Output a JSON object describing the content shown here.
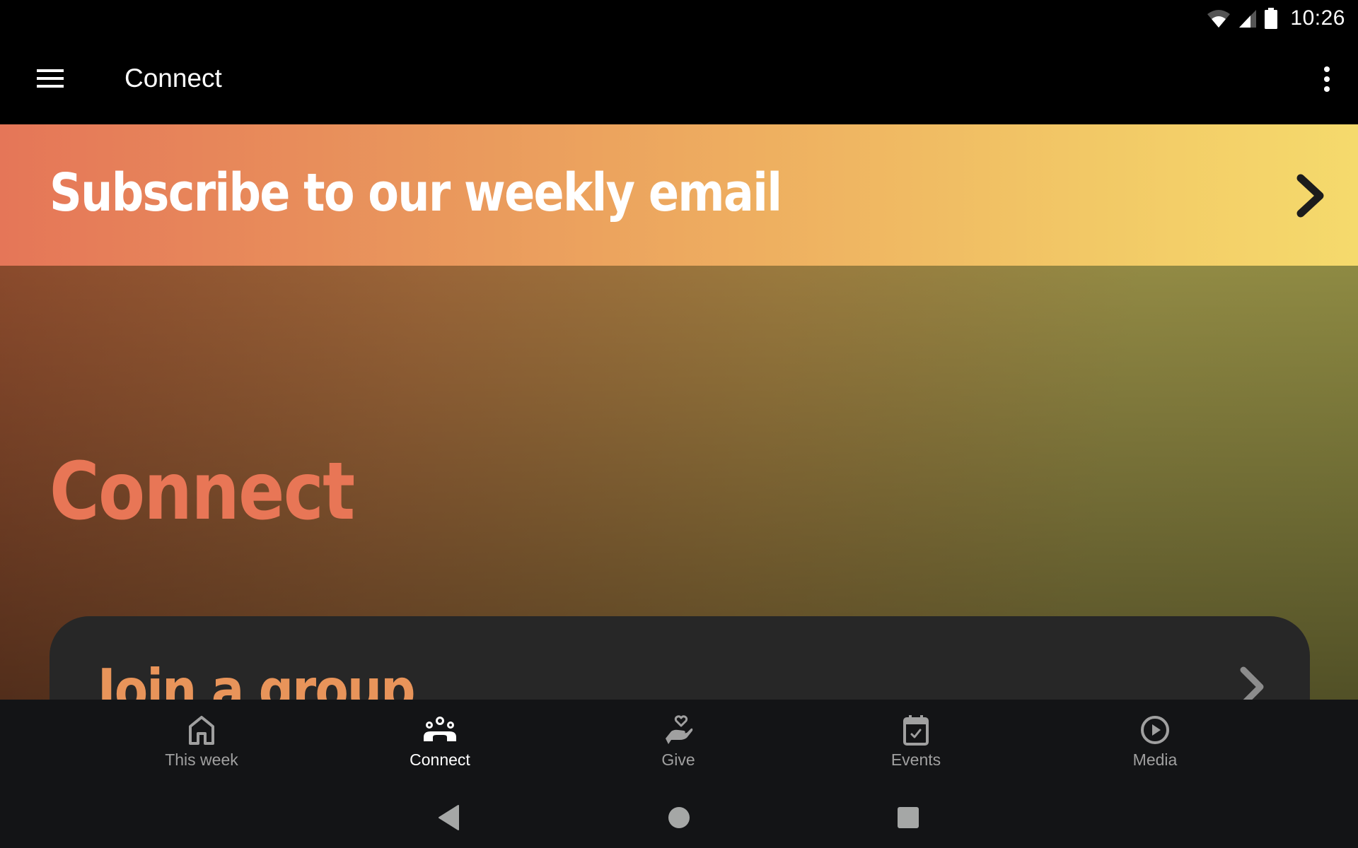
{
  "status_bar": {
    "time": "10:26",
    "icons": [
      "wifi-icon",
      "cell-signal-icon",
      "battery-icon"
    ]
  },
  "app_bar": {
    "menu_icon": "hamburger-menu-icon",
    "title": "Connect",
    "overflow_icon": "more-vert-icon"
  },
  "subscribe_banner": {
    "label": "Subscribe to our weekly email",
    "icon": "chevron-right-icon"
  },
  "hero": {
    "title": "Connect"
  },
  "cards": [
    {
      "label": "Join a group",
      "icon": "chevron-right-icon"
    }
  ],
  "bottom_nav": {
    "items": [
      {
        "label": "This week",
        "icon": "home-icon",
        "active": false
      },
      {
        "label": "Connect",
        "icon": "people-group-icon",
        "active": true
      },
      {
        "label": "Give",
        "icon": "hand-heart-icon",
        "active": false
      },
      {
        "label": "Events",
        "icon": "calendar-check-icon",
        "active": false
      },
      {
        "label": "Media",
        "icon": "play-circle-icon",
        "active": false
      }
    ]
  },
  "system_nav": {
    "buttons": [
      "back",
      "home",
      "recents"
    ]
  },
  "colors": {
    "accent_coral": "#e87656",
    "accent_orange": "#e8945a",
    "banner_start": "#e57658",
    "banner_end": "#f5da6c",
    "nav_bg": "#131416",
    "card_bg": "#272727",
    "inactive": "#a0a0a0"
  }
}
